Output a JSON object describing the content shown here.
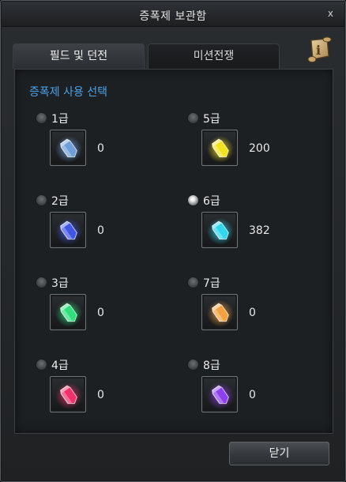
{
  "window": {
    "title": "증폭제 보관함",
    "close_glyph": "x"
  },
  "tabs": [
    {
      "label": "필드 및 던전",
      "active": true
    },
    {
      "label": "미션전쟁",
      "active": false
    }
  ],
  "info_icon": "scroll-info-icon",
  "section_title": "증폭제 사용 선택",
  "grades": [
    {
      "label": "1급",
      "count": "0",
      "checked": false,
      "color": "#6f9fd8"
    },
    {
      "label": "2급",
      "count": "0",
      "checked": false,
      "color": "#3f57e6"
    },
    {
      "label": "3급",
      "count": "0",
      "checked": false,
      "color": "#2fe07a"
    },
    {
      "label": "4급",
      "count": "0",
      "checked": false,
      "color": "#f0306a"
    },
    {
      "label": "5급",
      "count": "200",
      "checked": false,
      "color": "#f2e21c"
    },
    {
      "label": "6급",
      "count": "382",
      "checked": true,
      "color": "#2fd6ee"
    },
    {
      "label": "7급",
      "count": "0",
      "checked": false,
      "color": "#f2a040"
    },
    {
      "label": "8급",
      "count": "0",
      "checked": false,
      "color": "#8e3ff0"
    }
  ],
  "footer": {
    "close_label": "닫기"
  }
}
